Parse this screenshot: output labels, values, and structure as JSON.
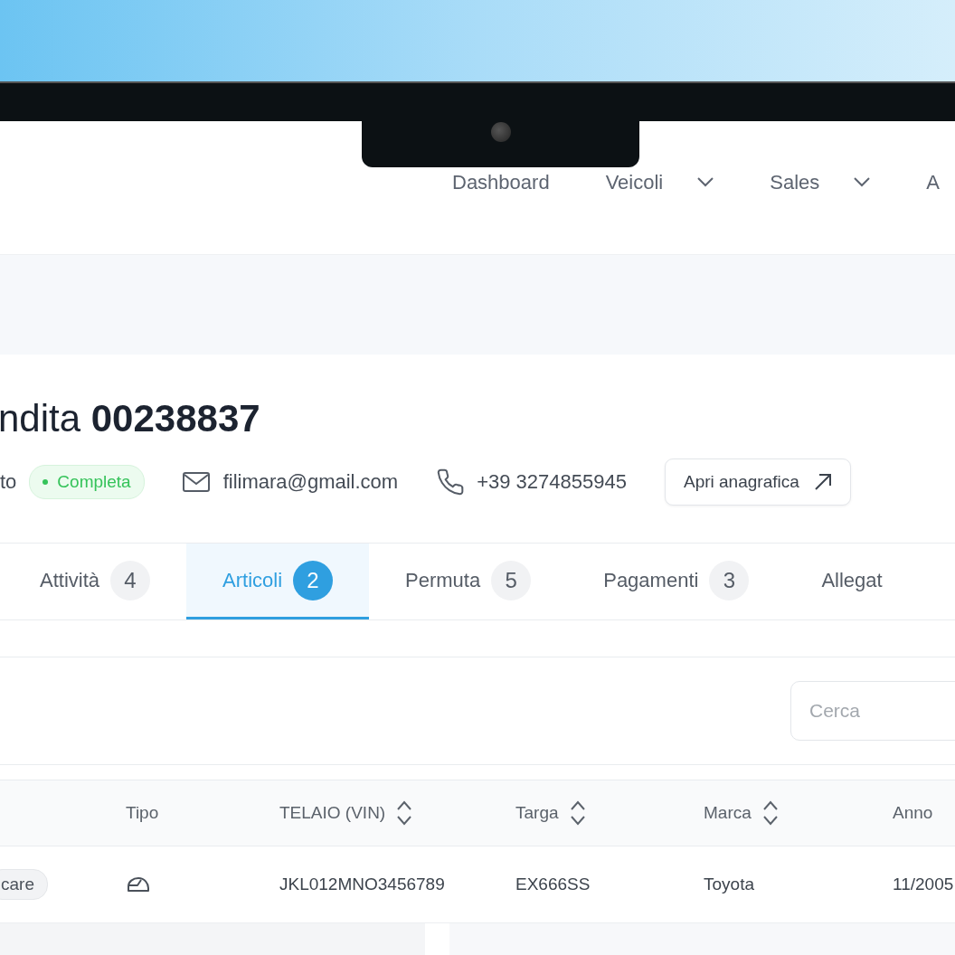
{
  "nav": {
    "items": [
      {
        "label": "Dashboard",
        "dropdown": false
      },
      {
        "label": "Veicoli",
        "dropdown": true
      },
      {
        "label": "Sales",
        "dropdown": true
      },
      {
        "label": "A",
        "dropdown": false
      }
    ]
  },
  "header": {
    "title": "ndita **00238837**",
    "status_prefix": "to",
    "status": {
      "label": "Completa"
    },
    "email": "filimara@gmail.com",
    "phone": "+39 3274855945",
    "open_button": "Apri anagrafica"
  },
  "tabs": [
    {
      "label": "Attività",
      "count": "4",
      "selected": false
    },
    {
      "label": "Articoli",
      "count": "2",
      "selected": true
    },
    {
      "label": "Permuta",
      "count": "5",
      "selected": false
    },
    {
      "label": "Pagamenti",
      "count": "3",
      "selected": false
    },
    {
      "label": "Allegat",
      "selected": false
    }
  ],
  "search": {
    "placeholder": "Cerca"
  },
  "table": {
    "columns": [
      {
        "label": "Tipo",
        "sortable": false
      },
      {
        "label": "TELAIO (VIN)",
        "sortable": true
      },
      {
        "label": "Targa",
        "sortable": true
      },
      {
        "label": "Marca",
        "sortable": true
      },
      {
        "label": "Anno",
        "sortable": false
      }
    ],
    "rows": [
      {
        "category": "care",
        "vin": "JKL012MNO3456789",
        "targa": "EX666SS",
        "marca": "Toyota",
        "anno": "11/2005"
      }
    ]
  }
}
